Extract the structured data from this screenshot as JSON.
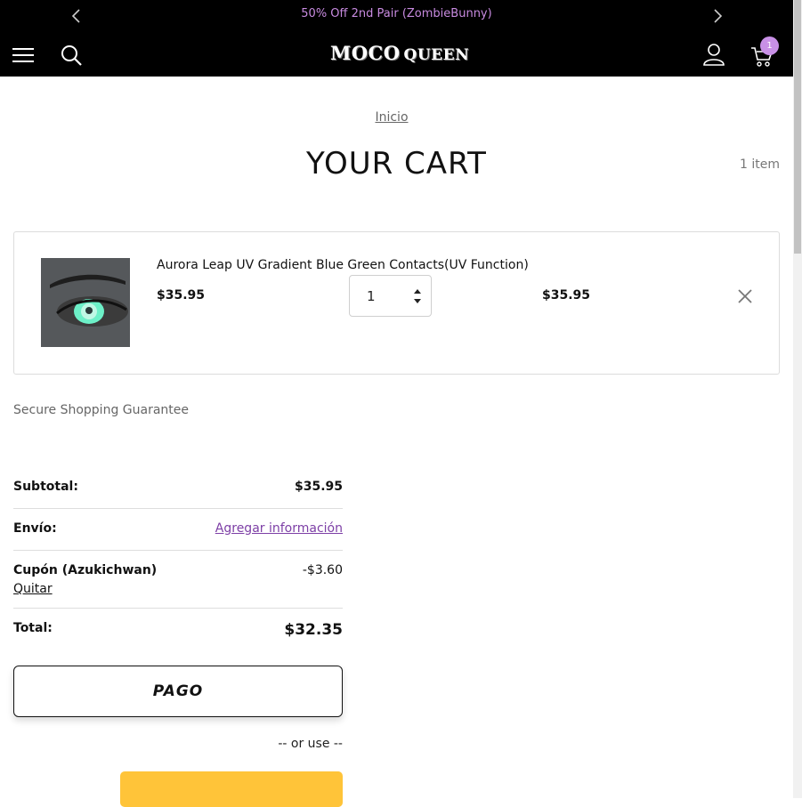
{
  "announcement": {
    "text": "50% Off 2nd Pair (ZombieBunny)",
    "color": "#c88be0"
  },
  "header": {
    "logo_main": "MOCO",
    "logo_secondary": "QUEEN",
    "cart_count": "1",
    "icons": [
      "menu-icon",
      "search-icon",
      "account-icon",
      "cart-icon"
    ]
  },
  "breadcrumb": {
    "home": "Inicio"
  },
  "page": {
    "title": "YOUR CART",
    "item_count": "1 item"
  },
  "cart": {
    "items": [
      {
        "title": "Aurora Leap UV Gradient Blue Green Contacts(UV Function)",
        "price": "$35.95",
        "quantity": "1",
        "line_total": "$35.95"
      }
    ]
  },
  "secure_text": "Secure Shopping Guarantee",
  "summary": {
    "subtotal_label": "Subtotal:",
    "subtotal_value": "$35.95",
    "shipping_label": "Envío:",
    "shipping_link": "Agregar información",
    "coupon_label": "Cupón (Azukichwan)",
    "coupon_remove": "Quitar",
    "coupon_value": "-$3.60",
    "total_label": "Total:",
    "total_value": "$32.35"
  },
  "checkout": {
    "label": "PAGO",
    "or_use": "-- or use --"
  },
  "colors": {
    "accent": "#c890e6",
    "link": "#7d3fa6",
    "paypal": "#ffc439"
  }
}
